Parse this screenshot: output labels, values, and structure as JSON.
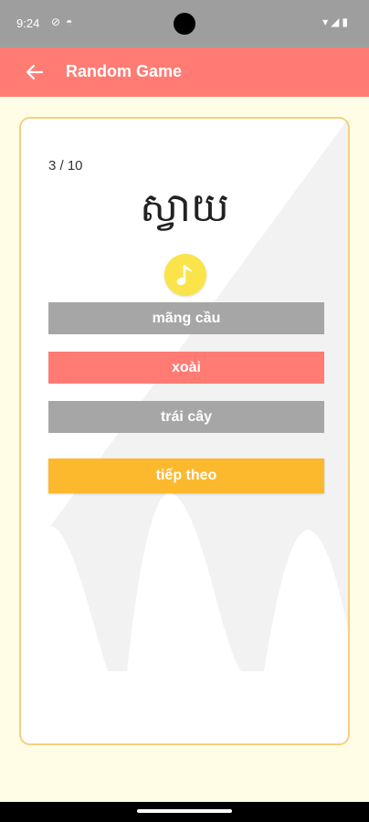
{
  "status_bar": {
    "time": "9:24",
    "left_icons": [
      "vpn-icon",
      "notification-icon"
    ],
    "right_icons": [
      "wifi-icon",
      "signal-icon",
      "battery-icon"
    ]
  },
  "app_bar": {
    "title": "Random Game",
    "back_icon": "arrow-left-icon",
    "color": "#ff7b73"
  },
  "quiz": {
    "progress": "3 / 10",
    "word": "ស្វាយ",
    "audio_icon": "music-note-icon",
    "options": [
      {
        "label": "mãng cầu",
        "state": "neutral"
      },
      {
        "label": "xoài",
        "state": "selected"
      },
      {
        "label": "trái cây",
        "state": "neutral"
      }
    ],
    "next_label": "tiếp theo"
  },
  "colors": {
    "background": "#fffde5",
    "card_border": "#f6cf7c",
    "option_neutral": "#a6a6a6",
    "option_selected": "#ff7b73",
    "next_button": "#fcb92e",
    "audio_button": "#fbe44a"
  }
}
